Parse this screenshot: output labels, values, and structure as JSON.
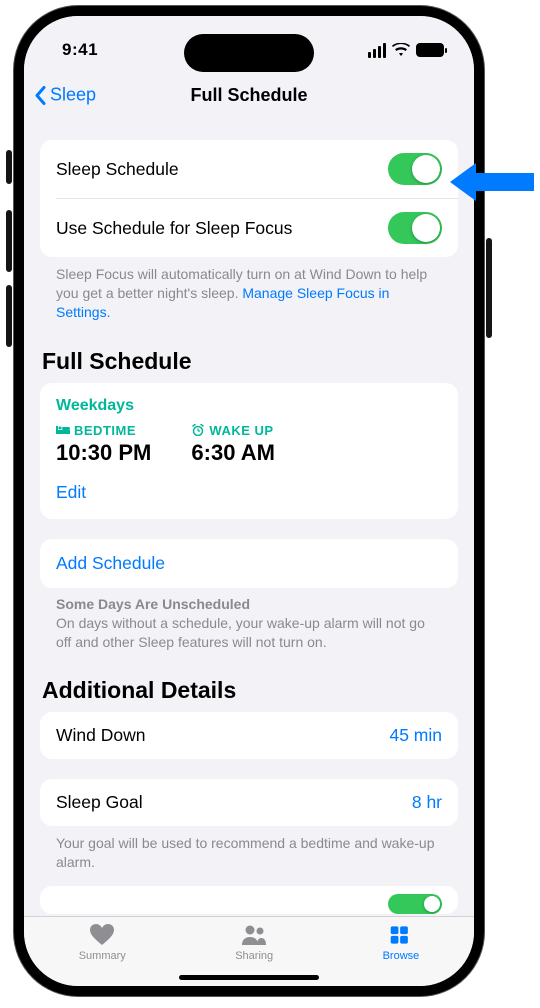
{
  "status": {
    "time": "9:41"
  },
  "nav": {
    "back_label": "Sleep",
    "title": "Full Schedule"
  },
  "schedule_toggles": {
    "sleep_schedule_label": "Sleep Schedule",
    "use_focus_label": "Use Schedule for Sleep Focus",
    "footer_text": "Sleep Focus will automatically turn on at Wind Down to help you get a better night's sleep. ",
    "footer_link": "Manage Sleep Focus in Settings."
  },
  "full_schedule": {
    "header": "Full Schedule",
    "days_label": "Weekdays",
    "bedtime_label": "BEDTIME",
    "bedtime_value": "10:30 PM",
    "wakeup_label": "WAKE UP",
    "wakeup_value": "6:30 AM",
    "edit_label": "Edit",
    "add_label": "Add Schedule",
    "unsched_head": "Some Days Are Unscheduled",
    "unsched_body": "On days without a schedule, your wake-up alarm will not go off and other Sleep features will not turn on."
  },
  "details": {
    "header": "Additional Details",
    "wind_down_label": "Wind Down",
    "wind_down_value": "45 min",
    "sleep_goal_label": "Sleep Goal",
    "sleep_goal_value": "8 hr",
    "goal_footer": "Your goal will be used to recommend a bedtime and wake-up alarm."
  },
  "tabs": {
    "summary": "Summary",
    "sharing": "Sharing",
    "browse": "Browse"
  }
}
